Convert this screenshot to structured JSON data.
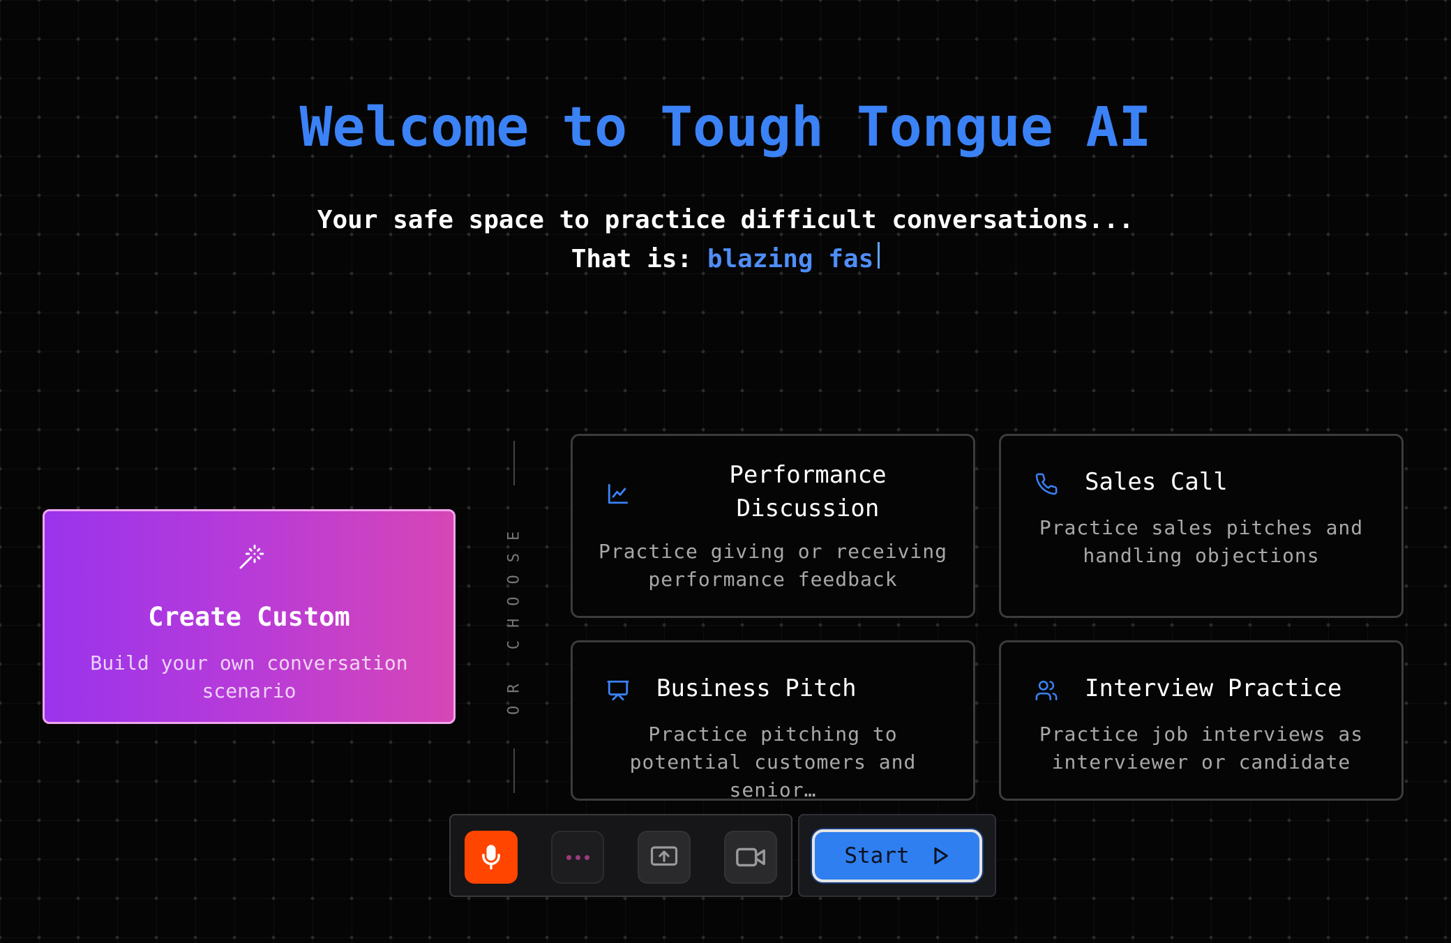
{
  "header": {
    "title": "Welcome to Tough Tongue AI",
    "subtitle": "Your safe space to practice difficult conversations...",
    "tagline_prefix": "That is:",
    "tagline_typed": "blazing fas"
  },
  "custom_card": {
    "title": "Create Custom",
    "description": "Build your own conversation scenario",
    "icon": "wand-sparkles-icon"
  },
  "divider": {
    "label": "OR CHOOSE"
  },
  "scenarios": [
    {
      "title": "Performance Discussion",
      "description": "Practice giving or receiving performance feedback",
      "icon": "line-chart-icon"
    },
    {
      "title": "Sales Call",
      "description": "Practice sales pitches and handling objections",
      "icon": "phone-icon"
    },
    {
      "title": "Business Pitch",
      "description": "Practice pitching to potential customers and senior…",
      "icon": "presentation-icon"
    },
    {
      "title": "Interview Practice",
      "description": "Practice job interviews as interviewer or candidate",
      "icon": "users-icon"
    }
  ],
  "controls": {
    "mic_icon": "microphone-icon",
    "more_icon": "more-dots-icon",
    "share_icon": "screen-share-icon",
    "video_icon": "video-camera-icon"
  },
  "start_button": {
    "label": "Start",
    "icon": "play-icon"
  },
  "colors": {
    "accent": "#3b82f6",
    "mic": "#ff4500",
    "custom_start": "#9a34ec",
    "custom_end": "#d646b6"
  }
}
